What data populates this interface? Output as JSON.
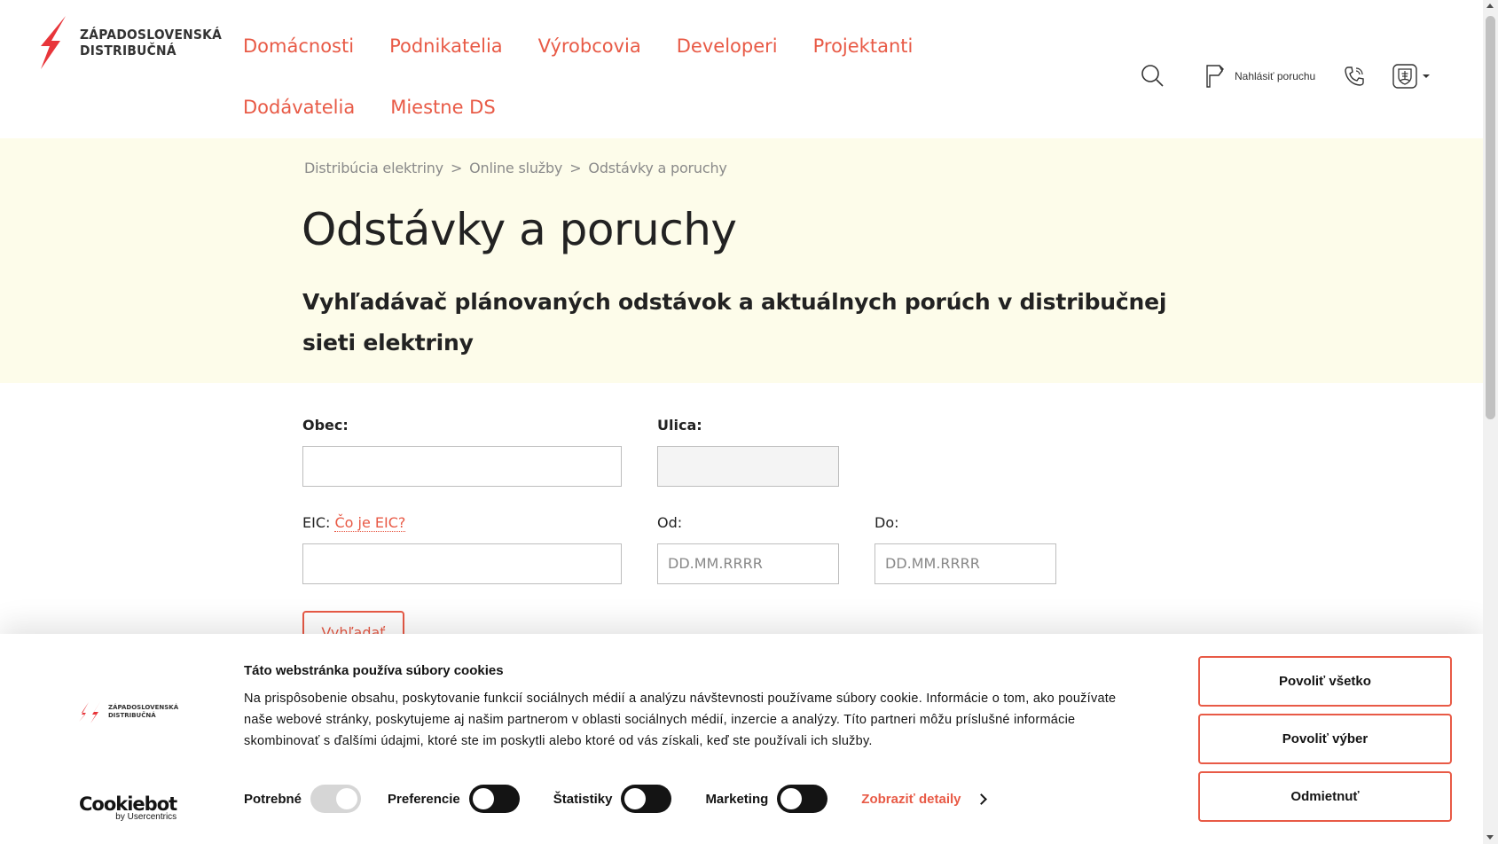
{
  "brand": {
    "line1": "ZÁPADOSLOVENSKÁ",
    "line2": "DISTRIBUČNÁ",
    "accent": "#e85a46"
  },
  "nav": {
    "items": [
      "Domácnosti",
      "Podnikatelia",
      "Výrobcovia",
      "Developeri",
      "Projektanti",
      "Dodávatelia",
      "Miestne DS"
    ]
  },
  "tools": {
    "search_icon": "search-icon",
    "report_label": "Nahlásiť poruchu",
    "phone_icon": "phone-icon",
    "lang_icon": "slovak-coat-of-arms-icon"
  },
  "breadcrumb": {
    "items": [
      "Distribúcia elektriny",
      "Online služby",
      "Odstávky a poruchy"
    ],
    "separator": ">"
  },
  "page": {
    "title": "Odstávky a poruchy",
    "subtitle": "Vyhľadávač plánovaných odstávok a aktuálnych porúch v distribučnej sieti elektriny"
  },
  "form": {
    "obec_label": "Obec:",
    "ulica_label": "Ulica:",
    "eic_label": "EIC:",
    "eic_link": "Čo je EIC?",
    "od_label": "Od:",
    "do_label": "Do:",
    "obec_value": "",
    "ulica_value": "",
    "eic_value": "",
    "od_placeholder": "DD.MM.RRRR",
    "do_placeholder": "DD.MM.RRRR",
    "search_button": "Vyhľadať"
  },
  "cookie": {
    "title": "Táto webstránka používa súbory cookies",
    "text": "Na prispôsobenie obsahu, poskytovanie funkcií sociálnych médií a analýzu návštevnosti používame súbory cookie. Informácie o tom, ako používate naše webové stránky, poskytujeme aj našim partnerom v oblasti sociálnych médií, inzercie a analýzy. Títo partneri môžu príslušné informácie skombinovať s ďalšími údajmi, ktoré ste im poskytli alebo ktoré od vás získali, keď ste používali ich služby.",
    "toggles": [
      {
        "label": "Potrebné",
        "state": "disabled-on"
      },
      {
        "label": "Preferencie",
        "state": "off"
      },
      {
        "label": "Štatistiky",
        "state": "off"
      },
      {
        "label": "Marketing",
        "state": "off"
      }
    ],
    "details_link": "Zobraziť detaily",
    "btn_allow_all": "Povoliť všetko",
    "btn_allow_selection": "Povoliť výber",
    "btn_decline": "Odmietnuť",
    "cookiebot_brand": "Cookiebot",
    "cookiebot_sub": "by Usercentrics"
  }
}
